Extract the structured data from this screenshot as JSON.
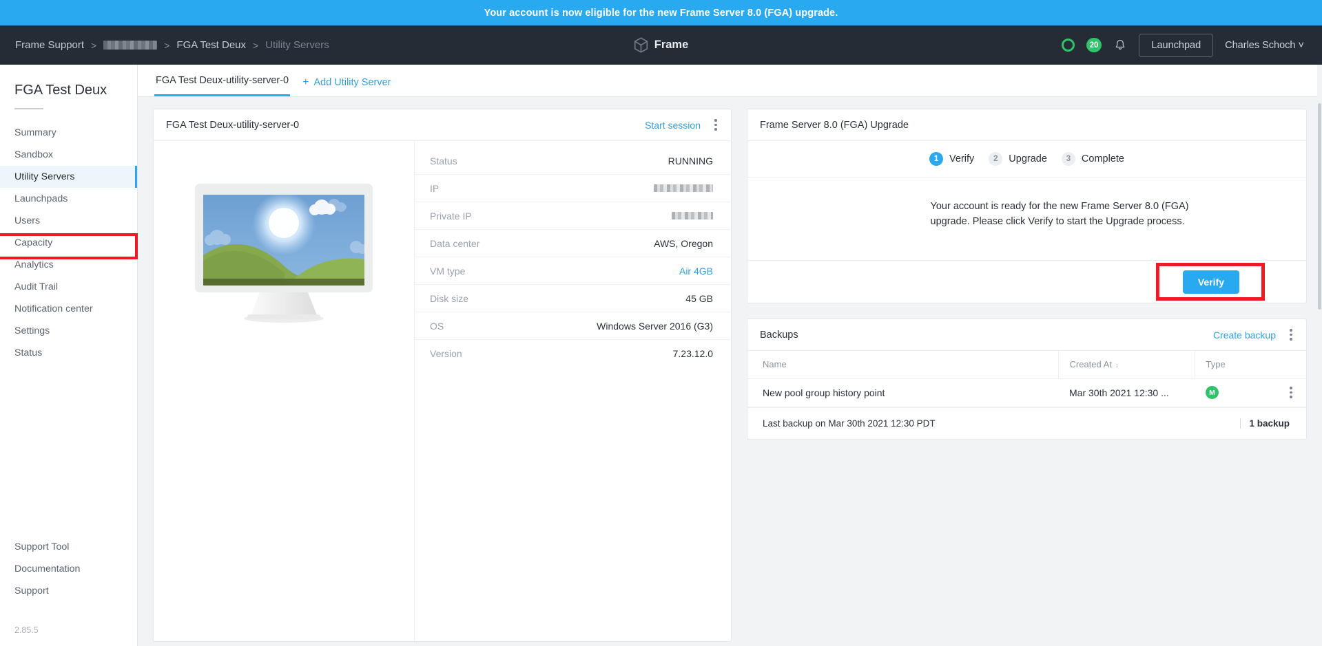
{
  "announcement": {
    "text": "Your account is now eligible for the new Frame Server 8.0 (FGA) upgrade."
  },
  "header": {
    "breadcrumb": [
      {
        "label": "Frame Support",
        "type": "link"
      },
      {
        "label": "",
        "type": "redacted"
      },
      {
        "label": "FGA Test Deux",
        "type": "link"
      },
      {
        "label": "Utility Servers",
        "type": "current"
      }
    ],
    "separator": ">",
    "brand": "Frame",
    "status_ring_icon": "status-ring-icon",
    "count_badge": "20",
    "bell_icon": "bell-icon",
    "launchpad_label": "Launchpad",
    "user_name": "Charles Schoch",
    "user_caret": "˅"
  },
  "sidebar": {
    "title": "FGA Test Deux",
    "items": [
      {
        "label": "Summary",
        "active": false
      },
      {
        "label": "Sandbox",
        "active": false
      },
      {
        "label": "Utility Servers",
        "active": true
      },
      {
        "label": "Launchpads",
        "active": false
      },
      {
        "label": "Users",
        "active": false
      },
      {
        "label": "Capacity",
        "active": false
      },
      {
        "label": "Analytics",
        "active": false
      },
      {
        "label": "Audit Trail",
        "active": false
      },
      {
        "label": "Notification center",
        "active": false
      },
      {
        "label": "Settings",
        "active": false
      },
      {
        "label": "Status",
        "active": false
      }
    ],
    "bottom_items": [
      {
        "label": "Support Tool"
      },
      {
        "label": "Documentation"
      },
      {
        "label": "Support"
      }
    ],
    "version": "2.85.5"
  },
  "tabs": {
    "active_tab": "FGA Test Deux-utility-server-0",
    "add_label": "Add Utility Server",
    "add_icon": "plus-icon"
  },
  "server_card": {
    "title": "FGA Test Deux-utility-server-0",
    "start_session_label": "Start session",
    "kebab_icon": "kebab-menu-icon",
    "thumbnail_icon": "desktop-monitor-illustration",
    "specs": [
      {
        "key": "Status",
        "value": "RUNNING",
        "style": "normal"
      },
      {
        "key": "IP",
        "value": "",
        "style": "redacted"
      },
      {
        "key": "Private IP",
        "value": "",
        "style": "redacted-short"
      },
      {
        "key": "Data center",
        "value": "AWS, Oregon",
        "style": "normal"
      },
      {
        "key": "VM type",
        "value": "Air 4GB",
        "style": "accent"
      },
      {
        "key": "Disk size",
        "value": "45 GB",
        "style": "normal"
      },
      {
        "key": "OS",
        "value": "Windows Server 2016 (G3)",
        "style": "normal"
      },
      {
        "key": "Version",
        "value": "7.23.12.0",
        "style": "normal"
      }
    ]
  },
  "upgrade_card": {
    "title": "Frame Server 8.0 (FGA) Upgrade",
    "steps": [
      {
        "num": "1",
        "label": "Verify",
        "active": true
      },
      {
        "num": "2",
        "label": "Upgrade",
        "active": false
      },
      {
        "num": "3",
        "label": "Complete",
        "active": false
      }
    ],
    "body_text": "Your account is ready for the new Frame Server 8.0 (FGA) upgrade. Please click Verify to start the Upgrade process.",
    "verify_button": "Verify"
  },
  "backups_card": {
    "title": "Backups",
    "create_label": "Create backup",
    "kebab_icon": "kebab-menu-icon",
    "columns": [
      "Name",
      "Created At",
      "Type",
      ""
    ],
    "sort_column": "Created At",
    "rows": [
      {
        "name": "New pool group history point",
        "created_at": "Mar 30th 2021 12:30 ...",
        "type_badge": "M",
        "row_kebab": "kebab-menu-icon"
      }
    ],
    "footer_note": "Last backup on Mar 30th 2021 12:30 PDT",
    "footer_count": "1 backup"
  },
  "colors": {
    "accent_blue": "#29a9ef",
    "dark_header": "#262c36",
    "green": "#2fc36a",
    "highlight_red": "#ed1c24",
    "page_bg": "#f1f3f5"
  }
}
